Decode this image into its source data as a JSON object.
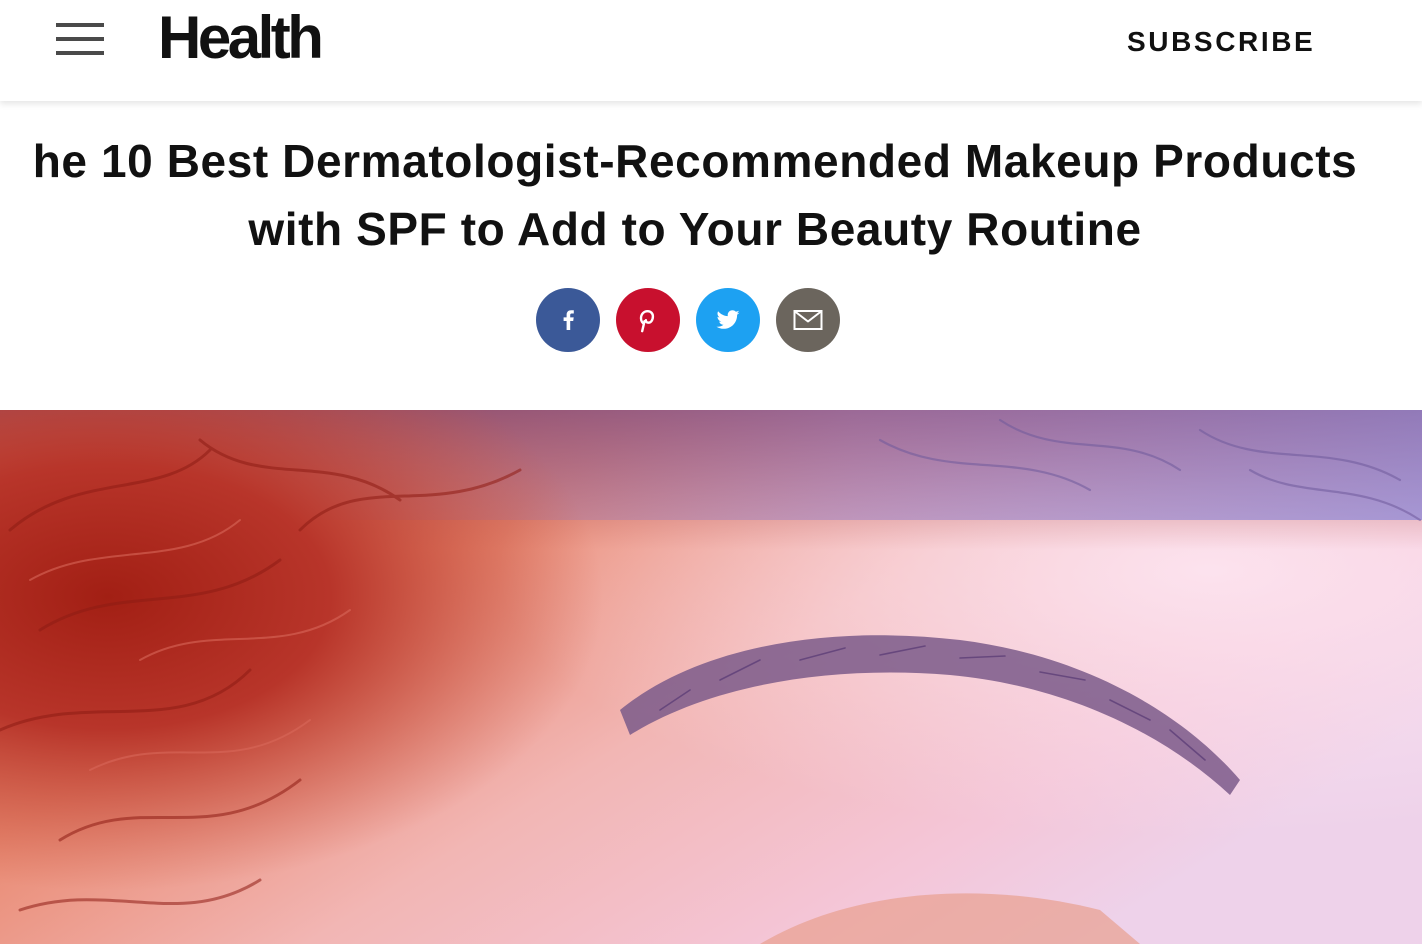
{
  "header": {
    "menu_icon": "hamburger-menu-icon",
    "logo_text": "Health",
    "subscribe_label": "SUBSCRIBE"
  },
  "article": {
    "title_line1": "he 10 Best Dermatologist-Recommended Makeup Products",
    "title_line2": "with SPF to Add to Your Beauty Routine"
  },
  "share": {
    "buttons": [
      {
        "name": "facebook",
        "icon": "facebook-icon",
        "color": "#3b5998"
      },
      {
        "name": "pinterest",
        "icon": "pinterest-icon",
        "color": "#c8102e"
      },
      {
        "name": "twitter",
        "icon": "twitter-icon",
        "color": "#1da1f2"
      },
      {
        "name": "email",
        "icon": "email-icon",
        "color": "#6b655d"
      }
    ]
  },
  "colors": {
    "text": "#111111",
    "background": "#ffffff"
  }
}
